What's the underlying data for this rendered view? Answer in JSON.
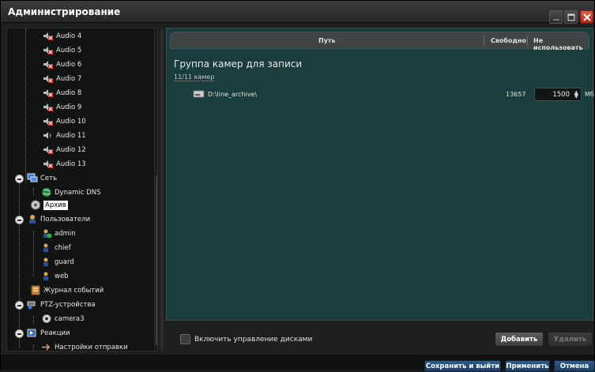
{
  "window": {
    "title": "Администрирование"
  },
  "tree": {
    "items": [
      {
        "label": "Audio 4",
        "icon": "audio-disabled-icon"
      },
      {
        "label": "Audio 5",
        "icon": "audio-disabled-icon"
      },
      {
        "label": "Audio 6",
        "icon": "audio-disabled-icon"
      },
      {
        "label": "Audio 7",
        "icon": "audio-disabled-icon"
      },
      {
        "label": "Audio 8",
        "icon": "audio-disabled-icon"
      },
      {
        "label": "Audio 9",
        "icon": "audio-disabled-icon"
      },
      {
        "label": "Audio 10",
        "icon": "audio-disabled-icon"
      },
      {
        "label": "Audio 11",
        "icon": "audio-icon"
      },
      {
        "label": "Audio 12",
        "icon": "audio-disabled-icon"
      },
      {
        "label": "Audio 13",
        "icon": "audio-disabled-icon"
      },
      {
        "label": "Сеть",
        "icon": "network-icon"
      },
      {
        "label": "Dynamic DNS",
        "icon": "globe-icon"
      },
      {
        "label": "Архив",
        "icon": "archive-icon"
      },
      {
        "label": "Пользователи",
        "icon": "users-icon"
      },
      {
        "label": "admin",
        "icon": "user-admin-icon"
      },
      {
        "label": "chief",
        "icon": "user-icon"
      },
      {
        "label": "guard",
        "icon": "user-icon"
      },
      {
        "label": "web",
        "icon": "user-icon"
      },
      {
        "label": "Журнал событий",
        "icon": "event-log-icon"
      },
      {
        "label": "PTZ-устройства",
        "icon": "ptz-icon"
      },
      {
        "label": "camera3",
        "icon": "camera-icon"
      },
      {
        "label": "Реакции",
        "icon": "reactions-icon"
      },
      {
        "label": "Настройки отправки",
        "icon": "send-settings-icon"
      }
    ]
  },
  "table": {
    "col_path": "Путь",
    "col_free": "Свободно",
    "col_unused": "Не использовать"
  },
  "group": {
    "title": "Группа камер для записи",
    "count": "11/11 камер"
  },
  "disk": {
    "path": "D:\\line_archive\\",
    "free": "13657",
    "unused_value": "1500",
    "unit": "Мб"
  },
  "controls": {
    "enable_disks": "Включить управление дисками",
    "add": "Добавить",
    "delete": "Удалить"
  },
  "footer": {
    "save_exit": "Сохранить и выйти",
    "apply": "Применить",
    "cancel": "Отмена"
  },
  "colors": {
    "accent_blue": "#2f5a8a",
    "panel_teal": "#1a3d3d",
    "close_red": "#d04030"
  }
}
